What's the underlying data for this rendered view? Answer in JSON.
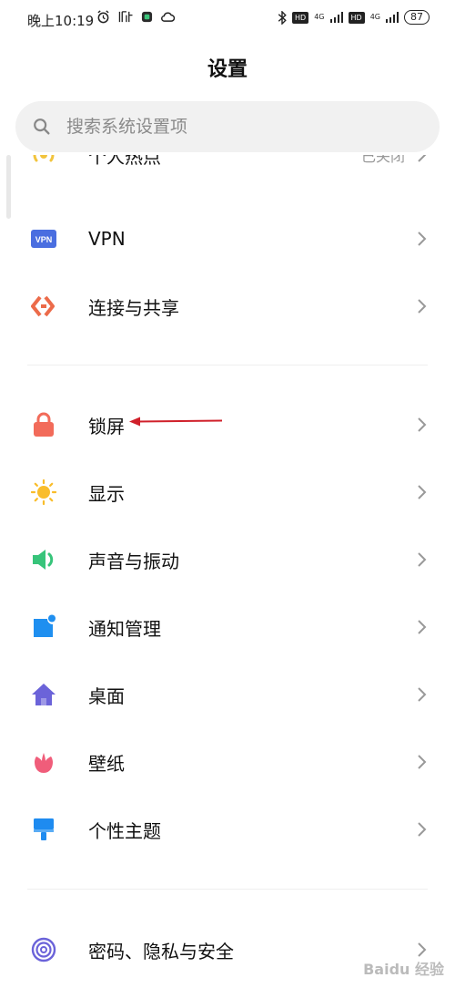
{
  "status_bar": {
    "time": "晚上10:19",
    "left_icons": [
      "alarm-icon",
      "listen-icon",
      "app-icon",
      "cloud-icon"
    ],
    "right_icons": [
      "bluetooth-icon",
      "hd-icon",
      "signal-icon",
      "hd-icon",
      "signal-icon"
    ],
    "hd1": "HD",
    "net1": "4G",
    "hd2": "HD",
    "net2": "4G",
    "battery": "87"
  },
  "header": {
    "title": "设置"
  },
  "search": {
    "placeholder": "搜索系统设置项"
  },
  "colors": {
    "hotspot": "#f2c43d",
    "vpn": "#4a6ee0",
    "share": "#ec6b4a",
    "lock": "#f26b5a",
    "display": "#f9bd2b",
    "sound": "#37c47a",
    "notify": "#1f8ff0",
    "desktop": "#6b63d9",
    "wallpaper": "#f05d7a",
    "theme": "#1e8bf0",
    "privacy": "#6b63d9",
    "annotation": "#d0202a"
  },
  "settings": {
    "hotspot": {
      "label": "个人热点",
      "value": "已关闭",
      "icon": "hotspot-icon"
    },
    "vpn": {
      "label": "VPN",
      "icon": "vpn-icon",
      "icon_text": "VPN"
    },
    "share": {
      "label": "连接与共享",
      "icon": "share-icon"
    },
    "lock": {
      "label": "锁屏",
      "icon": "lock-icon"
    },
    "display": {
      "label": "显示",
      "icon": "sun-icon"
    },
    "sound": {
      "label": "声音与振动",
      "icon": "speaker-icon"
    },
    "notify": {
      "label": "通知管理",
      "icon": "notification-icon"
    },
    "desktop": {
      "label": "桌面",
      "icon": "home-icon"
    },
    "wallpaper": {
      "label": "壁纸",
      "icon": "flower-icon"
    },
    "theme": {
      "label": "个性主题",
      "icon": "brush-icon"
    },
    "privacy": {
      "label": "密码、隐私与安全",
      "icon": "fingerprint-icon"
    }
  },
  "watermark": "Baidu 经验"
}
